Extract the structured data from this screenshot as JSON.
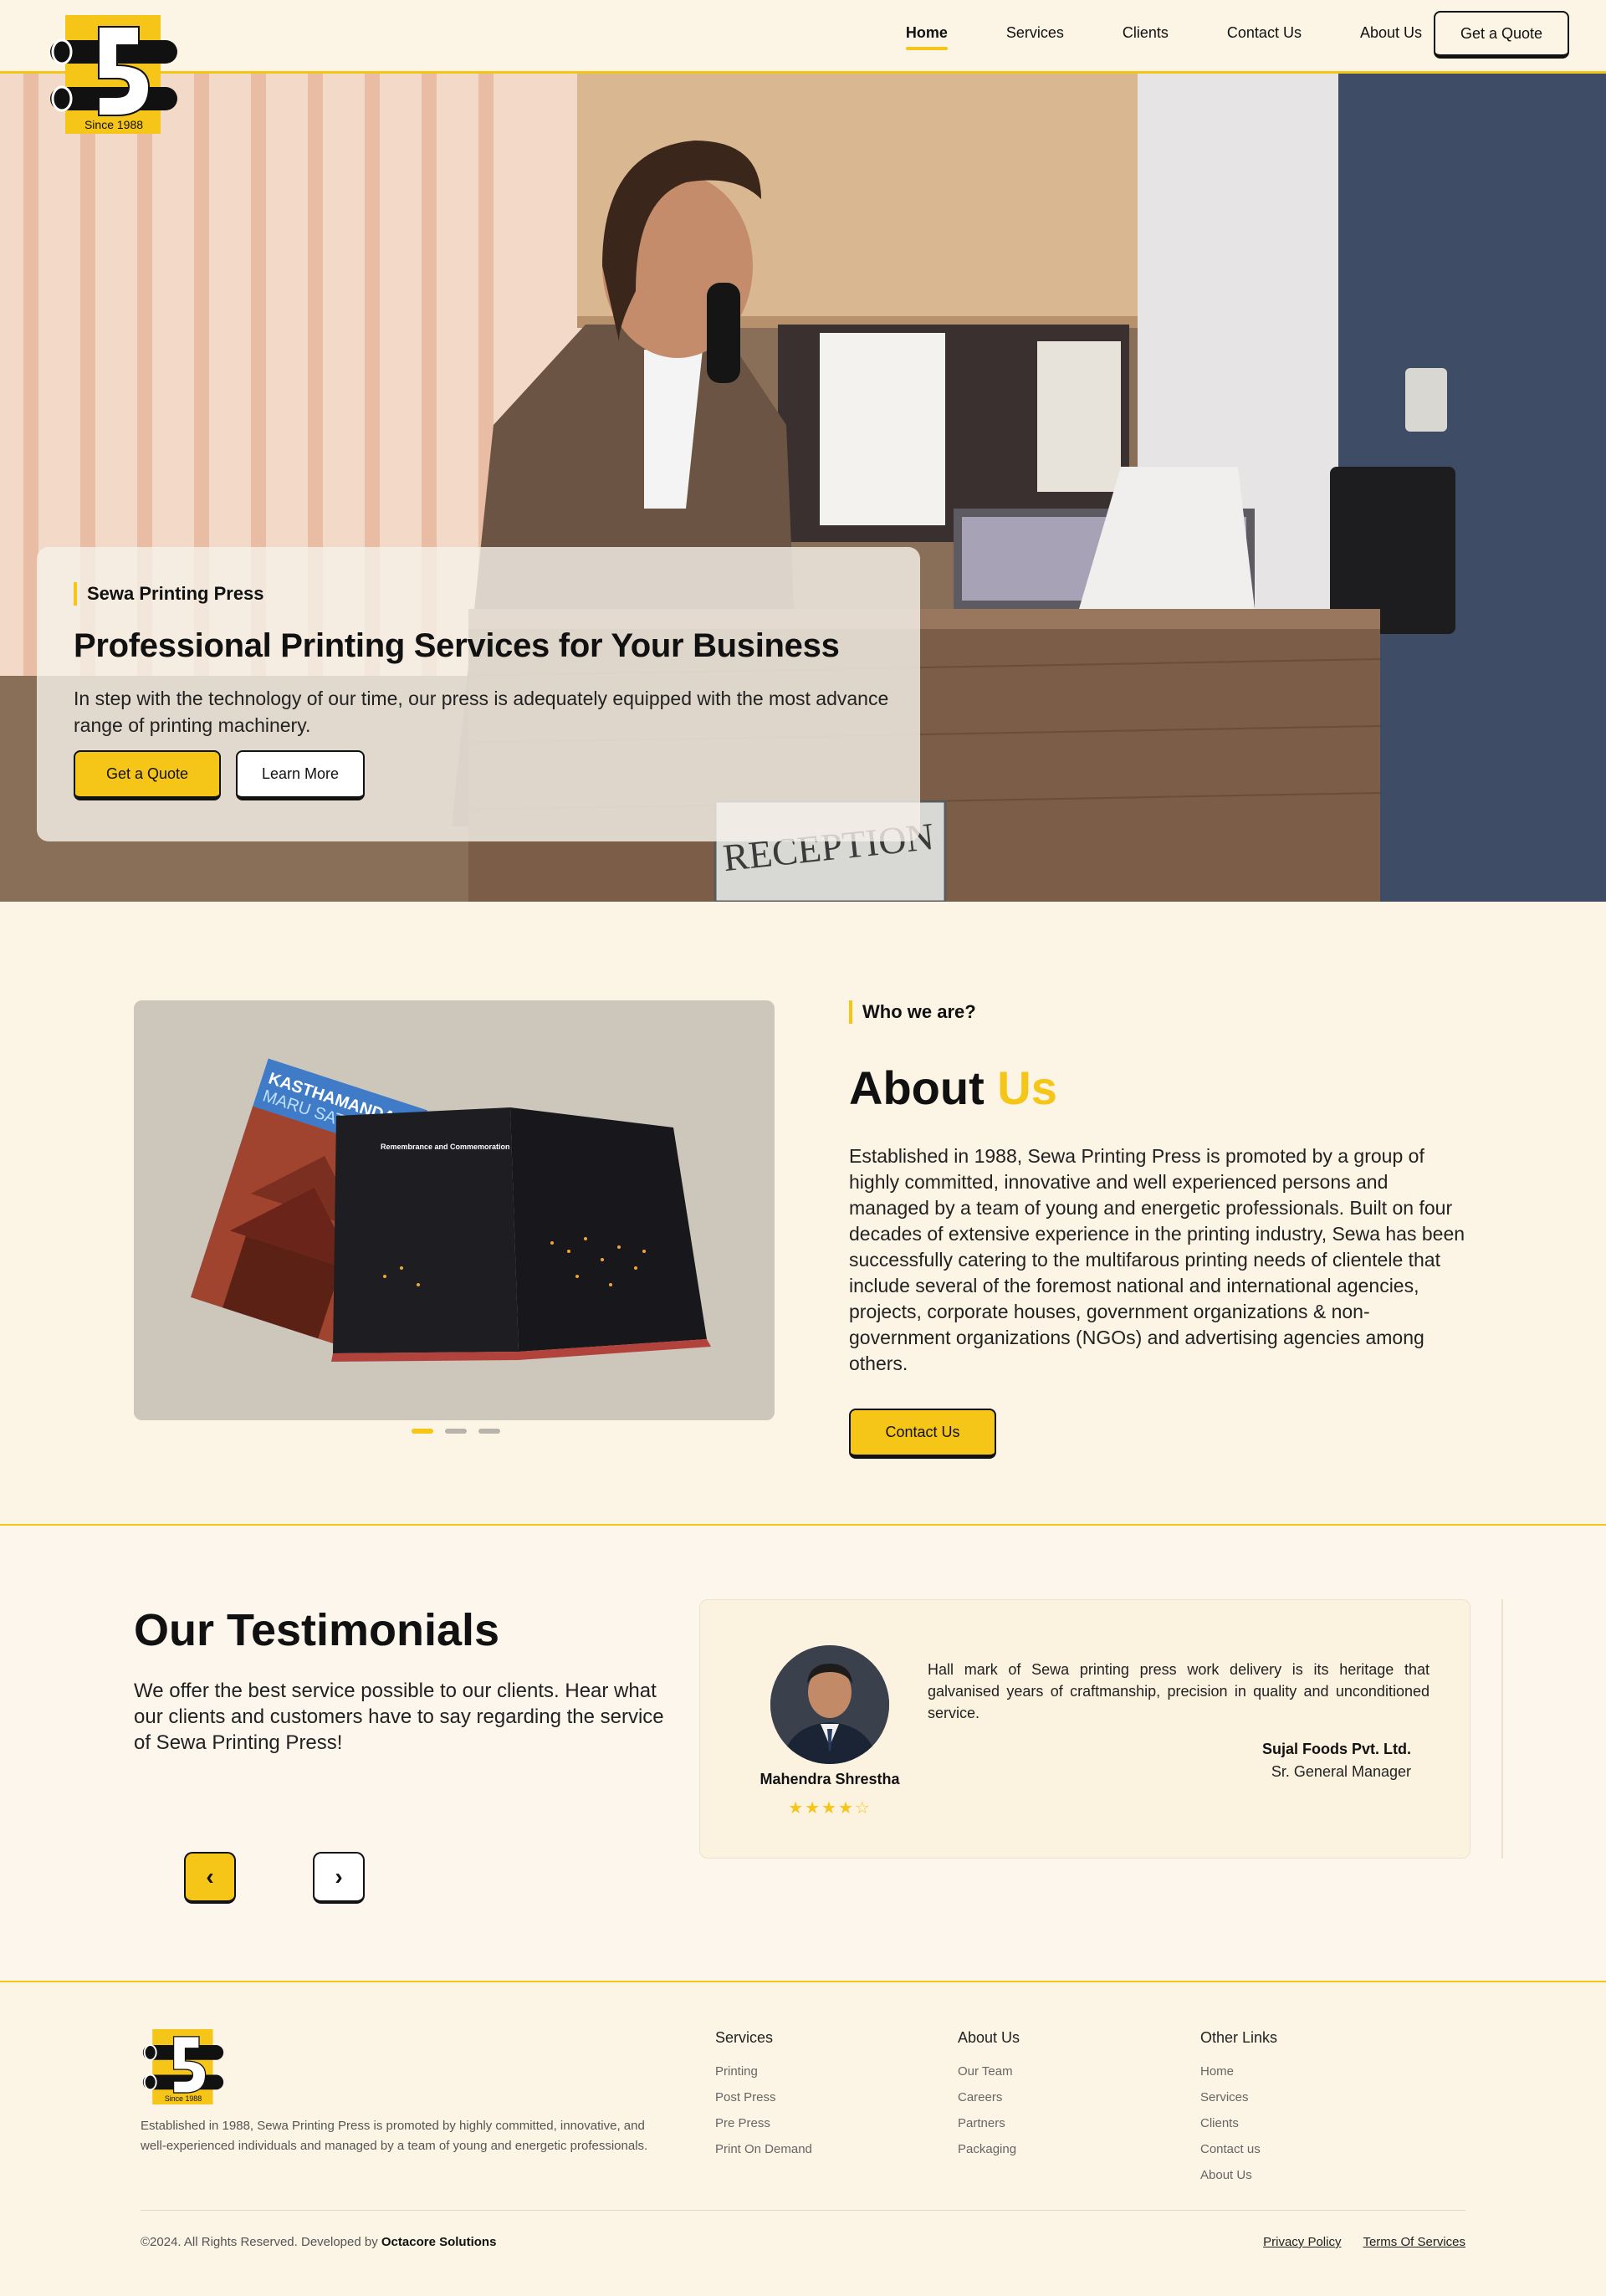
{
  "header": {
    "logo_text": "Since 1988",
    "nav": [
      "Home",
      "Services",
      "Clients",
      "Contact Us",
      "About Us"
    ],
    "cta": "Get a Quote"
  },
  "hero": {
    "tag": "Sewa Printing Press",
    "title": "Professional Printing Services for Your Business",
    "text": "In step with the technology of our time, our press is adequately equipped with the most advance range of printing machinery.",
    "primary_button": "Get a Quote",
    "secondary_button": "Learn More",
    "sign_text": "RECEPTION"
  },
  "about": {
    "tag": "Who we are?",
    "title_main": "About",
    "title_highlight": "Us",
    "body": "Established in 1988, Sewa Printing Press is promoted by a group of highly committed, innovative and well experienced persons and managed by a team of young and energetic professionals. Built on four decades of extensive experience in the printing industry, Sewa has been successfully catering to the multifarous printing needs of clientele that include several of the foremost national and international agencies, projects, corporate houses, government organizations & non-government organizations (NGOs) and advertising agencies among others.",
    "button": "Contact Us",
    "book_cover_title": "KASTHAMANDAP",
    "book_cover_subtitle": "MARU SATTA",
    "book_page_heading": "Remembrance and Commemoration",
    "slides_total": 3,
    "slides_active": 1
  },
  "testimonials": {
    "title": "Our Testimonials",
    "subtitle": "We offer the best service possible to our clients. Hear what our clients and customers have to say regarding the service of Sewa Printing Press!",
    "prev": "‹",
    "next": "›",
    "card": {
      "name": "Mahendra Shrestha",
      "rating": 4,
      "stars": "★★★★☆",
      "quote": "Hall mark of Sewa printing press work delivery is its heritage that galvanised years of craftmanship, precision in quality and unconditioned service.",
      "company": "Sujal Foods Pvt. Ltd.",
      "role": "Sr. General Manager"
    }
  },
  "footer": {
    "logo_text": "Since 1988",
    "description": "Established in 1988, Sewa Printing Press is promoted by highly committed, innovative, and well-experienced individuals and managed by a team of young and energetic professionals.",
    "columns": [
      {
        "title": "Services",
        "items": [
          "Printing",
          "Post Press",
          "Pre Press",
          "Print On Demand"
        ]
      },
      {
        "title": "About Us",
        "items": [
          "Our Team",
          "Careers",
          "Partners",
          "Packaging"
        ]
      },
      {
        "title": "Other Links",
        "items": [
          "Home",
          "Services",
          "Clients",
          "Contact us",
          "About Us"
        ]
      }
    ],
    "copyright": "©2024. All Rights Reserved. Developed by",
    "developer": "Octacore Solutions",
    "legal": [
      "Privacy Policy",
      "Terms Of Services"
    ]
  },
  "colors": {
    "accent": "#f5c518",
    "background": "#fcf4e4",
    "text": "#111111"
  }
}
